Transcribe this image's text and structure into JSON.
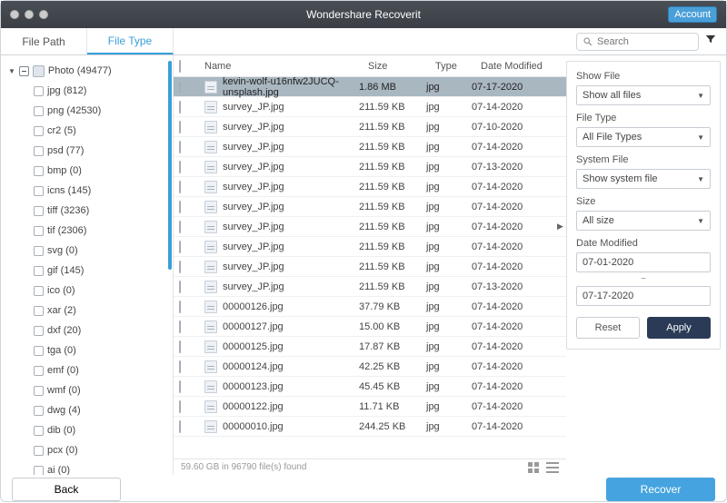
{
  "app_title": "Wondershare Recoverit",
  "account_label": "Account",
  "tabs": {
    "file_path": "File Path",
    "file_type": "File Type"
  },
  "search": {
    "placeholder": "Search"
  },
  "sidebar": {
    "category_label": "Photo (49477)",
    "formats": [
      {
        "label": "jpg (812)"
      },
      {
        "label": "png (42530)"
      },
      {
        "label": "cr2 (5)"
      },
      {
        "label": "psd (77)"
      },
      {
        "label": "bmp (0)"
      },
      {
        "label": "icns (145)"
      },
      {
        "label": "tiff (3236)"
      },
      {
        "label": "tif (2306)"
      },
      {
        "label": "svg (0)"
      },
      {
        "label": "gif (145)"
      },
      {
        "label": "ico (0)"
      },
      {
        "label": "xar (2)"
      },
      {
        "label": "dxf (20)"
      },
      {
        "label": "tga (0)"
      },
      {
        "label": "emf (0)"
      },
      {
        "label": "wmf (0)"
      },
      {
        "label": "dwg (4)"
      },
      {
        "label": "dib (0)"
      },
      {
        "label": "pcx (0)"
      },
      {
        "label": "ai (0)"
      }
    ]
  },
  "columns": {
    "name": "Name",
    "size": "Size",
    "type": "Type",
    "date": "Date Modified"
  },
  "files": [
    {
      "name": "kevin-wolf-u16nfw2JUCQ-unsplash.jpg",
      "size": "1.86 MB",
      "type": "jpg",
      "date": "07-17-2020",
      "selected": true
    },
    {
      "name": "survey_JP.jpg",
      "size": "211.59 KB",
      "type": "jpg",
      "date": "07-14-2020"
    },
    {
      "name": "survey_JP.jpg",
      "size": "211.59 KB",
      "type": "jpg",
      "date": "07-10-2020"
    },
    {
      "name": "survey_JP.jpg",
      "size": "211.59 KB",
      "type": "jpg",
      "date": "07-14-2020"
    },
    {
      "name": "survey_JP.jpg",
      "size": "211.59 KB",
      "type": "jpg",
      "date": "07-13-2020"
    },
    {
      "name": "survey_JP.jpg",
      "size": "211.59 KB",
      "type": "jpg",
      "date": "07-14-2020"
    },
    {
      "name": "survey_JP.jpg",
      "size": "211.59 KB",
      "type": "jpg",
      "date": "07-14-2020"
    },
    {
      "name": "survey_JP.jpg",
      "size": "211.59 KB",
      "type": "jpg",
      "date": "07-14-2020",
      "expand": true
    },
    {
      "name": "survey_JP.jpg",
      "size": "211.59 KB",
      "type": "jpg",
      "date": "07-14-2020"
    },
    {
      "name": "survey_JP.jpg",
      "size": "211.59 KB",
      "type": "jpg",
      "date": "07-14-2020"
    },
    {
      "name": "survey_JP.jpg",
      "size": "211.59 KB",
      "type": "jpg",
      "date": "07-13-2020"
    },
    {
      "name": "00000126.jpg",
      "size": "37.79 KB",
      "type": "jpg",
      "date": "07-14-2020"
    },
    {
      "name": "00000127.jpg",
      "size": "15.00 KB",
      "type": "jpg",
      "date": "07-14-2020"
    },
    {
      "name": "00000125.jpg",
      "size": "17.87 KB",
      "type": "jpg",
      "date": "07-14-2020"
    },
    {
      "name": "00000124.jpg",
      "size": "42.25 KB",
      "type": "jpg",
      "date": "07-14-2020"
    },
    {
      "name": "00000123.jpg",
      "size": "45.45 KB",
      "type": "jpg",
      "date": "07-14-2020"
    },
    {
      "name": "00000122.jpg",
      "size": "11.71 KB",
      "type": "jpg",
      "date": "07-14-2020"
    },
    {
      "name": "00000010.jpg",
      "size": "244.25 KB",
      "type": "jpg",
      "date": "07-14-2020"
    }
  ],
  "status": "59.60 GB in 96790 file(s) found",
  "filters": {
    "show_file_label": "Show File",
    "show_file_value": "Show all files",
    "file_type_label": "File Type",
    "file_type_value": "All File Types",
    "system_file_label": "System File",
    "system_file_value": "Show system file",
    "size_label": "Size",
    "size_value": "All size",
    "date_label": "Date Modified",
    "date_from": "07-01-2020",
    "date_to": "07-17-2020",
    "reset": "Reset",
    "apply": "Apply"
  },
  "buttons": {
    "back": "Back",
    "recover": "Recover"
  }
}
